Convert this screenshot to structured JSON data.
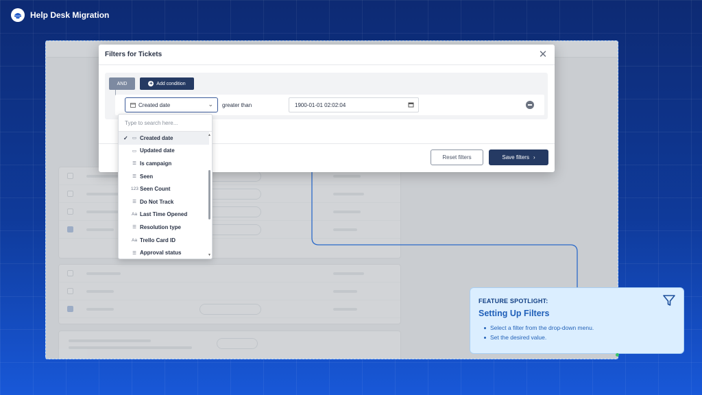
{
  "brand": {
    "name": "Help Desk Migration"
  },
  "modal": {
    "title": "Filters for Tickets",
    "and_label": "AND",
    "add_condition_label": "Add condition",
    "condition": {
      "field": "Created date",
      "operator": "greater than",
      "value": "1900-01-01 02:02:04"
    },
    "reset_label": "Reset filters",
    "save_label": "Save filters"
  },
  "dropdown": {
    "search_placeholder": "Type to search here...",
    "items": [
      {
        "label": "Created date",
        "icon": "calendar-icon",
        "selected": true
      },
      {
        "label": "Updated date",
        "icon": "calendar-icon",
        "selected": false
      },
      {
        "label": "Is campaign",
        "icon": "list-icon",
        "selected": false
      },
      {
        "label": "Seen",
        "icon": "list-icon",
        "selected": false
      },
      {
        "label": "Seen Count",
        "icon": "number-icon",
        "selected": false
      },
      {
        "label": "Do Not Track",
        "icon": "list-icon",
        "selected": false
      },
      {
        "label": "Last Time Opened",
        "icon": "text-icon",
        "selected": false
      },
      {
        "label": "Resolution type",
        "icon": "list-icon",
        "selected": false
      },
      {
        "label": "Trello Card ID",
        "icon": "text-icon",
        "selected": false
      },
      {
        "label": "Approval status",
        "icon": "list-icon",
        "selected": false
      }
    ]
  },
  "spotlight": {
    "kicker": "FEATURE SPOTLIGHT:",
    "title": "Setting Up Filters",
    "bullets": [
      "Select a filter from the drop-down menu.",
      "Set the desired value."
    ]
  },
  "colors": {
    "accent": "#253a63",
    "spotlight_bg": "#dbeeff",
    "spotlight_text": "#1f5fb8"
  }
}
